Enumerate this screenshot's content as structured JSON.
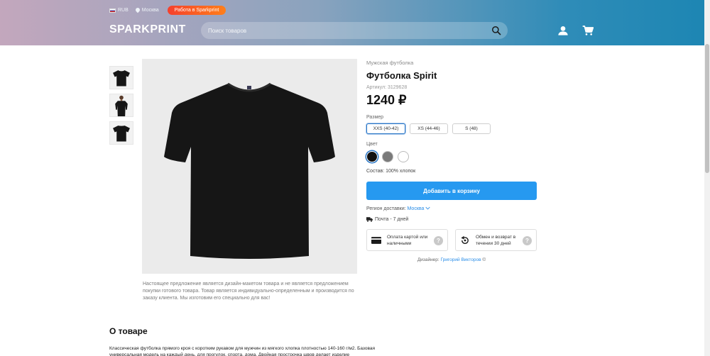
{
  "header": {
    "currency": "RUB",
    "city": "Москва",
    "work_label": "Работа в Sparkprint",
    "logo": "SPARKPRINT",
    "search_placeholder": "Поиск товаров",
    "icons": [
      "search-icon",
      "user-icon",
      "cart-icon"
    ],
    "gradient_colors": [
      "#c3a7bd",
      "#8aa3be",
      "#2f8cb8",
      "#1d86b3"
    ]
  },
  "gallery": {
    "thumbnails": [
      "tshirt-front",
      "model-photo",
      "tshirt-back"
    ],
    "disclaimer": "Настоящее предложение является дизайн-макетом товара и не является предложением покупки готового товара. Товар является индивидуально-определенным и производится по заказу клиента. Мы изготовим его специально для вас!"
  },
  "product": {
    "category": "Мужская футболка",
    "title": "Футболка Spirit",
    "sku": "Артикул: 3129628",
    "price": "1240 ₽",
    "size_label": "Размер",
    "sizes": [
      "XXS (40-42)",
      "XS (44-46)",
      "S (48)"
    ],
    "selected_size": "XXS (40-42)",
    "color_label": "Цвет",
    "colors": [
      "#111111",
      "#7a7a7a",
      "#ffffff"
    ],
    "selected_color": "#111111",
    "composition": "Состав: 100% хлопок",
    "cart_button": "Добавить в корзину",
    "region_label": "Регион доставки:",
    "region_city": "Москва",
    "delivery": "Почта - 7 дней",
    "payment_card": "Оплата картой или наличными",
    "return_card": "Обмен и возврат в течении 30 дней",
    "designer_label": "Дизайнер:",
    "designer_name": "Григорий Викторов",
    "designer_suffix": "©",
    "accent_color": "#2699f0"
  },
  "about": {
    "title": "О товаре",
    "text": "Классическая футболка прямого кроя с коротким рукавом для мужчин из мягкого хлопка плотностью 140-160 г/м2. Базовая универсальная модель на каждый день, для прогулок, спорта, дома. Двойная прострочка швов делает изделие"
  }
}
